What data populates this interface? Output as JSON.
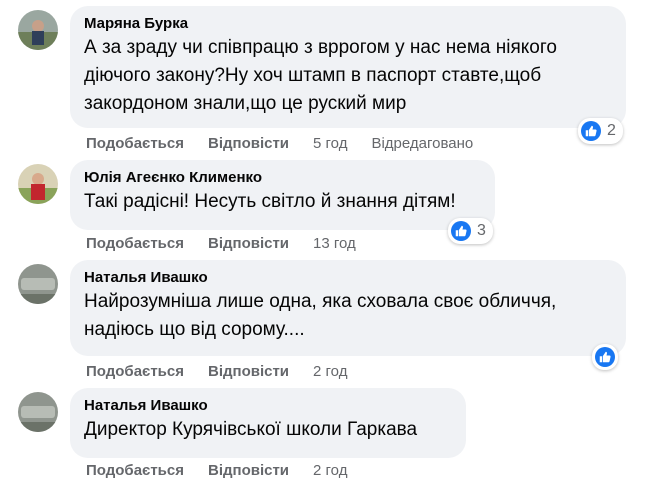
{
  "comments": [
    {
      "author": "Маряна Бурка",
      "text": "А за зраду чи співпрацю з вррогом у нас нема ніякого\nдіючого закону?Ну хоч штамп в паспорт ставте,щоб\nзакордоном знали,що це руский мир",
      "like_label": "Подобається",
      "reply_label": "Відповісти",
      "time": "5 год",
      "edited": "Відредаговано",
      "reaction_count": "2"
    },
    {
      "author": "Юлія Агеєнко Клименко",
      "text": "Такі радісні! Несуть світло й знання дітям!",
      "like_label": "Подобається",
      "reply_label": "Відповісти",
      "time": "13 год",
      "reaction_count": "3"
    },
    {
      "author": "Наталья Ивашко",
      "text": "Найрозумніша лише одна, яка сховала своє обличчя,\nнадіюсь що від сорому....",
      "like_label": "Подобається",
      "reply_label": "Відповісти",
      "time": "2 год",
      "reaction_count": ""
    },
    {
      "author": "Наталья Ивашко",
      "text": "Директор Курячівської школи Гаркава",
      "like_label": "Подобається",
      "reply_label": "Відповісти",
      "time": "2 год"
    }
  ],
  "colors": {
    "bubble_bg": "#f0f2f5",
    "action_text": "#65676b",
    "like_blue": "#1877f2"
  },
  "icons": [
    "like-icon",
    "avatar"
  ]
}
